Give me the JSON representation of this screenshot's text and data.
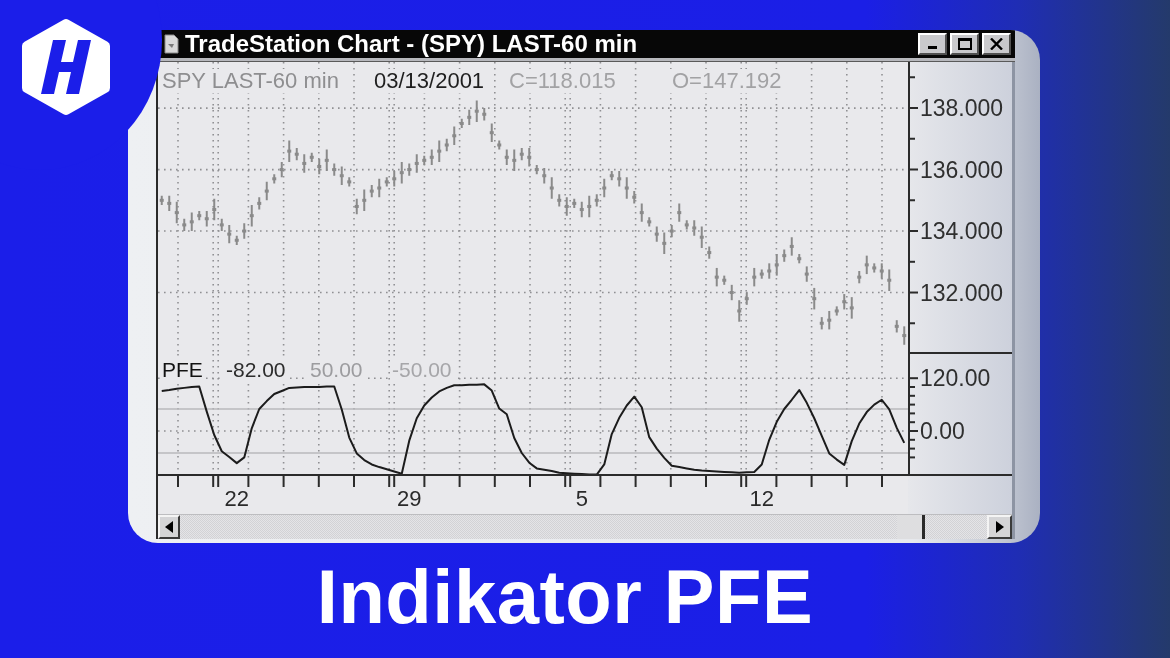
{
  "window": {
    "title": "TradeStation Chart - (SPY) LAST-60 min"
  },
  "price_panel": {
    "date": "03/13/2001",
    "close": "C=118.015",
    "open": "O=147.192",
    "chart_data": {
      "type": "scatter",
      "grid": true,
      "series": [
        {
          "name": "SPY LAST-60 min",
          "color": "#8a8a8a",
          "values": [
            135.0,
            134.9,
            134.6,
            134.2,
            134.3,
            134.5,
            134.4,
            134.7,
            134.2,
            133.9,
            133.7,
            134.0,
            134.5,
            134.9,
            135.3,
            135.7,
            136.0,
            136.6,
            136.5,
            136.2,
            136.4,
            136.1,
            136.3,
            136.0,
            135.8,
            135.6,
            134.8,
            135.0,
            135.3,
            135.4,
            135.6,
            135.7,
            135.9,
            136.0,
            136.2,
            136.3,
            136.4,
            136.6,
            136.8,
            137.1,
            137.5,
            137.7,
            137.9,
            137.8,
            137.2,
            136.8,
            136.4,
            136.3,
            136.5,
            136.4,
            136.0,
            135.8,
            135.4,
            135.0,
            134.8,
            134.9,
            134.7,
            134.8,
            135.0,
            135.4,
            135.8,
            135.7,
            135.4,
            135.1,
            134.6,
            134.3,
            133.9,
            133.6,
            134.0,
            134.6,
            134.2,
            134.1,
            133.8,
            133.3,
            132.5,
            132.4,
            132.0,
            131.4,
            131.8,
            132.5,
            132.6,
            132.7,
            132.9,
            133.2,
            133.5,
            133.1,
            132.6,
            131.8,
            131.0,
            131.1,
            131.4,
            131.7,
            131.5,
            132.5,
            132.9,
            132.8,
            132.7,
            132.4,
            130.9,
            130.6
          ],
          "errors": [
            0.15,
            0.25,
            0.35,
            0.2,
            0.3,
            0.15,
            0.25,
            0.35,
            0.2,
            0.3,
            0.15,
            0.25,
            0.35,
            0.2,
            0.3,
            0.15,
            0.25,
            0.35,
            0.2,
            0.3,
            0.15,
            0.25,
            0.35,
            0.2,
            0.3,
            0.15,
            0.25,
            0.35,
            0.2,
            0.3,
            0.15,
            0.25,
            0.35,
            0.2,
            0.3,
            0.15,
            0.25,
            0.35,
            0.2,
            0.3,
            0.15,
            0.25,
            0.35,
            0.2,
            0.3,
            0.15,
            0.25,
            0.35,
            0.2,
            0.3,
            0.15,
            0.25,
            0.35,
            0.2,
            0.3,
            0.15,
            0.25,
            0.35,
            0.2,
            0.3,
            0.15,
            0.25,
            0.35,
            0.2,
            0.3,
            0.15,
            0.25,
            0.35,
            0.2,
            0.3,
            0.15,
            0.25,
            0.35,
            0.2,
            0.3,
            0.15,
            0.25,
            0.35,
            0.2,
            0.3,
            0.15,
            0.25,
            0.35,
            0.2,
            0.3,
            0.15,
            0.25,
            0.35,
            0.2,
            0.3,
            0.15,
            0.25,
            0.35,
            0.2,
            0.3,
            0.15,
            0.25,
            0.35,
            0.2,
            0.3
          ]
        }
      ],
      "ylim": [
        130,
        139.5
      ],
      "yticks": [
        {
          "value": 132,
          "label": "132.000"
        },
        {
          "value": 134,
          "label": "134.000"
        },
        {
          "value": 136,
          "label": "136.000"
        },
        {
          "value": 138,
          "label": "138.000"
        }
      ]
    }
  },
  "pfe_panel": {
    "value": "-82.00",
    "chart_data": {
      "type": "line",
      "grid": true,
      "categories": [
        null,
        null,
        null,
        null,
        null,
        null,
        null,
        null,
        null,
        null,
        "22",
        null,
        null,
        null,
        null,
        null,
        null,
        null,
        null,
        null,
        null,
        null,
        null,
        null,
        null,
        null,
        null,
        null,
        null,
        null,
        null,
        null,
        null,
        "29",
        null,
        null,
        null,
        null,
        null,
        null,
        null,
        null,
        null,
        null,
        null,
        null,
        null,
        null,
        null,
        null,
        null,
        null,
        null,
        null,
        null,
        null,
        "5",
        null,
        null,
        null,
        null,
        null,
        null,
        null,
        null,
        null,
        null,
        null,
        null,
        null,
        null,
        null,
        null,
        null,
        null,
        null,
        null,
        null,
        null,
        null,
        "12",
        null,
        null,
        null,
        null,
        null,
        null,
        null,
        null,
        null,
        null,
        null,
        null,
        null,
        null,
        null,
        null,
        null,
        null,
        null
      ],
      "series": [
        {
          "name": "PFE",
          "color": "#1c1c1c",
          "values": [
            91,
            93,
            96,
            98,
            100,
            101,
            44,
            -9,
            -46,
            -59,
            -73,
            -60,
            6,
            50,
            68,
            84,
            91,
            98,
            99,
            100,
            100,
            100,
            101,
            101,
            49,
            -15,
            -51,
            -66,
            -76,
            -82,
            -87,
            -92,
            -97,
            -22,
            29,
            58,
            76,
            90,
            98,
            104,
            104,
            105,
            105,
            106,
            92,
            51,
            38,
            -16,
            -50,
            -72,
            -85,
            -88,
            -91,
            -95,
            -96,
            -97,
            -98,
            -99,
            -99,
            -76,
            -7,
            30,
            58,
            78,
            54,
            -14,
            -40,
            -61,
            -79,
            -82,
            -85,
            -88,
            -90,
            -91,
            -92,
            -93,
            -94,
            -95,
            -94,
            -93,
            -76,
            -20,
            21,
            50,
            71,
            93,
            64,
            29,
            -11,
            -51,
            -65,
            -77,
            -23,
            17,
            43,
            60,
            71,
            49,
            7,
            -27
          ]
        }
      ],
      "ylim": [
        -100,
        175
      ],
      "yticks": [
        {
          "value": 0,
          "label": "0.00"
        },
        {
          "value": 120,
          "label": "120.00"
        }
      ],
      "ref_lines": [
        {
          "axis": "y",
          "value": 50,
          "label": "50.00"
        },
        {
          "axis": "y",
          "value": -50,
          "label": "-50.00"
        }
      ]
    }
  },
  "caption": "Indikator PFE"
}
